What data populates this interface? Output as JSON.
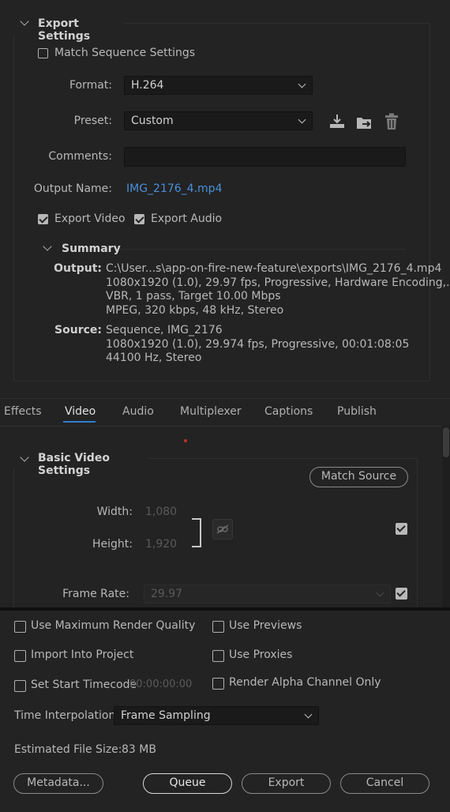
{
  "export_settings": {
    "title": "Export Settings",
    "match_sequence": {
      "label": "Match Sequence Settings",
      "checked": false
    },
    "format": {
      "label": "Format:",
      "value": "H.264"
    },
    "preset": {
      "label": "Preset:",
      "value": "Custom"
    },
    "preset_icons": [
      "save-preset-icon",
      "import-preset-icon",
      "delete-preset-icon"
    ],
    "comments": {
      "label": "Comments:",
      "value": ""
    },
    "output_name": {
      "label": "Output Name:",
      "value": "IMG_2176_4.mp4"
    },
    "export_video": {
      "label": "Export Video",
      "checked": true
    },
    "export_audio": {
      "label": "Export Audio",
      "checked": true
    },
    "summary": {
      "title": "Summary",
      "output_label": "Output:",
      "output_lines": [
        "C:\\User...s\\app-on-fire-new-feature\\exports\\IMG_2176_4.mp4",
        "1080x1920 (1.0), 29.97 fps, Progressive, Hardware Encoding,...",
        "VBR, 1 pass, Target 10.00 Mbps",
        "MPEG, 320 kbps, 48 kHz, Stereo"
      ],
      "source_label": "Source:",
      "source_lines": [
        "Sequence, IMG_2176",
        "1080x1920 (1.0), 29.974 fps, Progressive, 00:01:08:05",
        "44100 Hz, Stereo"
      ]
    }
  },
  "tabs": [
    {
      "label": "Effects",
      "active": false
    },
    {
      "label": "Video",
      "active": true
    },
    {
      "label": "Audio",
      "active": false
    },
    {
      "label": "Multiplexer",
      "active": false
    },
    {
      "label": "Captions",
      "active": false
    },
    {
      "label": "Publish",
      "active": false
    }
  ],
  "basic_video": {
    "title": "Basic Video Settings",
    "match_source_label": "Match Source",
    "width": {
      "label": "Width:",
      "value": "1,080",
      "checked": true
    },
    "height": {
      "label": "Height:",
      "value": "1,920"
    },
    "link_icon": "unlink-icon",
    "frame_rate": {
      "label": "Frame Rate:",
      "value": "29.97",
      "checked": true
    }
  },
  "options": {
    "max_render_quality": {
      "label": "Use Maximum Render Quality",
      "checked": false
    },
    "use_previews": {
      "label": "Use Previews",
      "checked": false
    },
    "import_into_project": {
      "label": "Import Into Project",
      "checked": false
    },
    "use_proxies": {
      "label": "Use Proxies",
      "checked": false
    },
    "set_start_timecode": {
      "label": "Set Start Timecode",
      "value": "00:00:00:00",
      "checked": false
    },
    "render_alpha": {
      "label": "Render Alpha Channel Only",
      "checked": false
    },
    "time_interpolation": {
      "label": "Time Interpolation:",
      "value": "Frame Sampling"
    },
    "estimated_file_size": {
      "label": "Estimated File Size:",
      "value": "83 MB"
    }
  },
  "buttons": {
    "metadata": "Metadata...",
    "queue": "Queue",
    "export": "Export",
    "cancel": "Cancel"
  },
  "colors": {
    "background": "#232323",
    "link": "#4a8fd9",
    "active_tab_underline": "#2d7fd4"
  }
}
